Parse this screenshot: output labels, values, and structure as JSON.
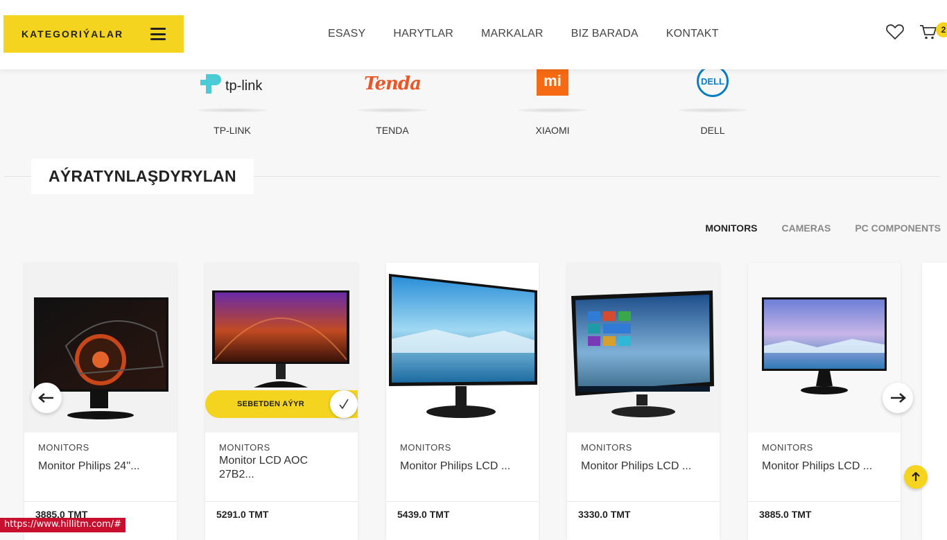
{
  "header": {
    "category_button": "KATEGORIÝALAR",
    "nav": [
      "ESASY",
      "HARYTLAR",
      "MARKALAR",
      "BIZ BARADA",
      "KONTAKT"
    ],
    "cart_count": "2"
  },
  "brands": [
    {
      "name": "TP-LINK",
      "logo_text": "tp-link"
    },
    {
      "name": "TENDA",
      "logo_text": "Tenda"
    },
    {
      "name": "XIAOMI",
      "logo_text": "mi"
    },
    {
      "name": "DELL",
      "logo_text": "DELL"
    }
  ],
  "section": {
    "title": "AÝRATYNLAŞDYRYLAN",
    "tabs": [
      "MONITORS",
      "CAMERAS",
      "PC COMPONENTS"
    ]
  },
  "products": [
    {
      "category": "MONITORS",
      "title": "Monitor Philips 24''...",
      "price": "3885.0 TMT"
    },
    {
      "category": "MONITORS",
      "title": "Monitor LCD AOC 27B2...",
      "price": "5291.0 TMT",
      "cart_label": "SEBETDEN AÝYR"
    },
    {
      "category": "MONITORS",
      "title": "Monitor Philips LCD ...",
      "price": "5439.0 TMT"
    },
    {
      "category": "MONITORS",
      "title": "Monitor Philips LCD ...",
      "price": "3330.0 TMT"
    },
    {
      "category": "MONITORS",
      "title": "Monitor Philips LCD ...",
      "price": "3885.0 TMT"
    }
  ],
  "status_url": "https://www.hillitm.com/#",
  "colors": {
    "accent": "#f5d41f",
    "status_bar": "#c8102e"
  }
}
